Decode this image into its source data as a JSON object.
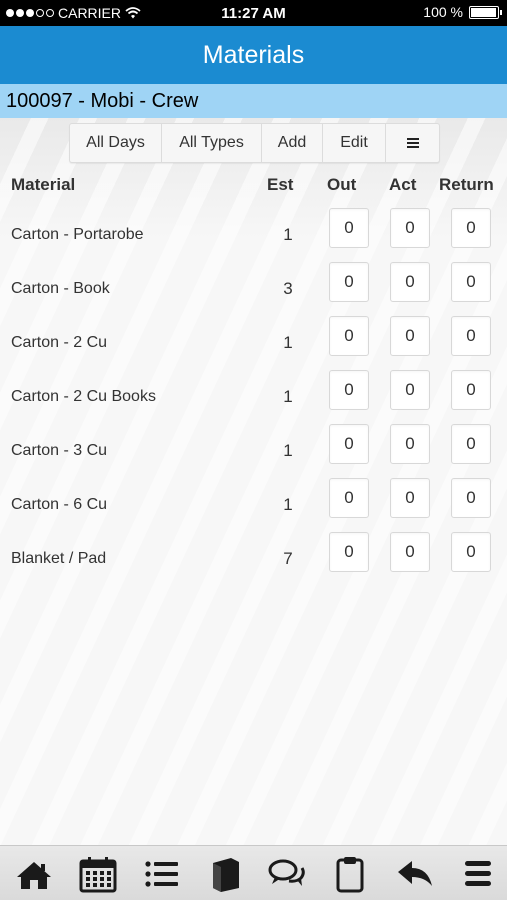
{
  "status_bar": {
    "carrier": "CARRIER",
    "time": "11:27 AM",
    "battery": "100 %",
    "battery_level": 1.0,
    "signal_bars_on": 3,
    "signal_bars_total": 5
  },
  "header": {
    "title": "Materials"
  },
  "job": {
    "label": "100097 - Mobi - Crew"
  },
  "toolbar": {
    "days_label": "All Days",
    "types_label": "All Types",
    "add_label": "Add",
    "edit_label": "Edit",
    "menu_icon": "menu-icon"
  },
  "table": {
    "columns": [
      "Material",
      "Est",
      "Out",
      "Act",
      "Return"
    ],
    "rows": [
      {
        "material": "Carton - Portarobe",
        "est": "1",
        "out": "0",
        "act": "0",
        "return": "0"
      },
      {
        "material": "Carton - Book",
        "est": "3",
        "out": "0",
        "act": "0",
        "return": "0"
      },
      {
        "material": "Carton - 2 Cu",
        "est": "1",
        "out": "0",
        "act": "0",
        "return": "0"
      },
      {
        "material": "Carton - 2 Cu Books",
        "est": "1",
        "out": "0",
        "act": "0",
        "return": "0"
      },
      {
        "material": "Carton - 3 Cu",
        "est": "1",
        "out": "0",
        "act": "0",
        "return": "0"
      },
      {
        "material": "Carton - 6 Cu",
        "est": "1",
        "out": "0",
        "act": "0",
        "return": "0"
      },
      {
        "material": "Blanket / Pad",
        "est": "7",
        "out": "0",
        "act": "0",
        "return": "0"
      }
    ]
  },
  "bottom_nav": [
    "home-icon",
    "calendar-icon",
    "list-icon",
    "book-icon",
    "chat-icon",
    "clipboard-icon",
    "reply-icon",
    "menu-icon"
  ],
  "colors": {
    "header": "#1b8bd1",
    "job_bar": "#9fd4f5",
    "background": "#f2f2f2"
  }
}
